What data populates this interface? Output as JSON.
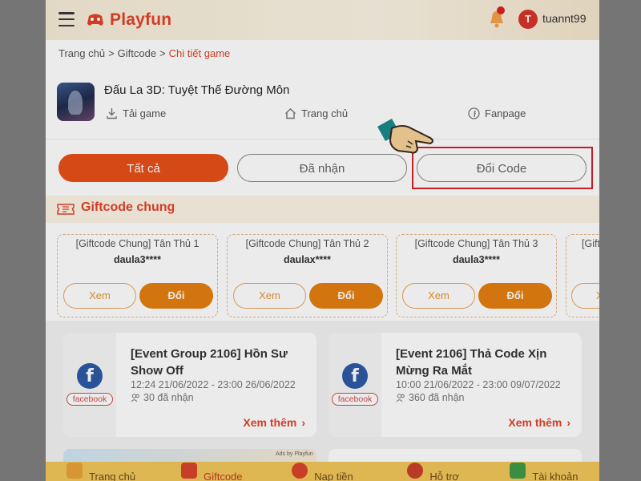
{
  "header": {
    "brand": "Playfun",
    "avatar_letter": "T",
    "username": "tuannt99"
  },
  "breadcrumb": {
    "items": [
      "Trang chủ",
      ">",
      "Giftcode",
      ">"
    ],
    "current": "Chi tiết game"
  },
  "game": {
    "title": "Đấu La 3D: Tuyệt Thế Đường Môn",
    "links": {
      "download": "Tải game",
      "home": "Trang chủ",
      "fanpage": "Fanpage"
    }
  },
  "tabs": {
    "all": "Tất cả",
    "received": "Đã nhận",
    "redeem": "Đổi Code"
  },
  "section": {
    "title": "Giftcode chung"
  },
  "codes": [
    {
      "name": "[Giftcode Chung] Tân Thủ 1",
      "code": "daula3****",
      "view": "Xem",
      "redeem": "Đổi"
    },
    {
      "name": "[Giftcode Chung] Tân Thủ 2",
      "code": "daulax****",
      "view": "Xem",
      "redeem": "Đổi"
    },
    {
      "name": "[Giftcode Chung] Tân Thủ 3",
      "code": "daula3****",
      "view": "Xem",
      "redeem": "Đổi"
    },
    {
      "name": "[Gift",
      "code": "",
      "view": "Xe",
      "redeem": ""
    }
  ],
  "events": [
    {
      "title": "[Event Group 2106] Hồn Sư Show Off",
      "time": "12:24 21/06/2022 - 23:00 26/06/2022",
      "count": "30 đã nhận",
      "tag": "facebook",
      "more": "Xem thêm"
    },
    {
      "title": "[Event 2106] Thả Code Xịn Mừng Ra Mắt",
      "time": "10:00 21/06/2022 - 23:00 09/07/2022",
      "count": "360 đã nhận",
      "tag": "facebook",
      "more": "Xem thêm"
    }
  ],
  "ads_label": "Ads by Playfun",
  "bottom_nav": {
    "home": "Trang chủ",
    "giftcode": "Giftcode",
    "topup": "Nạp tiền",
    "support": "Hỗ trợ",
    "account": "Tài khoản"
  },
  "colors": {
    "brand": "#e2432b",
    "primary_tab": "#e8501a",
    "redeem_button": "#e57f10",
    "highlight": "#d71f26",
    "facebook": "#2d5aa5"
  }
}
